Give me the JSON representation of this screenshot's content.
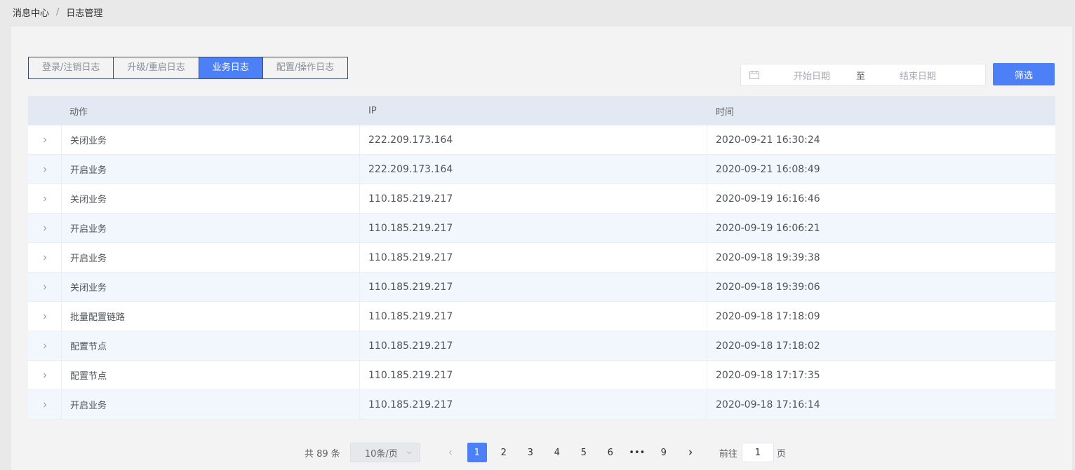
{
  "breadcrumb": {
    "parent": "消息中心",
    "separator": "/",
    "current": "日志管理"
  },
  "tabs": [
    {
      "label": "登录/注销日志",
      "active": false
    },
    {
      "label": "升级/重启日志",
      "active": false
    },
    {
      "label": "业务日志",
      "active": true
    },
    {
      "label": "配置/操作日志",
      "active": false
    }
  ],
  "date_range": {
    "start_placeholder": "开始日期",
    "separator": "至",
    "end_placeholder": "结束日期"
  },
  "filter_button": "筛选",
  "table": {
    "headers": {
      "action": "动作",
      "ip": "IP",
      "time": "时间"
    },
    "rows": [
      {
        "action": "关闭业务",
        "ip": "222.209.173.164",
        "time": "2020-09-21 16:30:24"
      },
      {
        "action": "开启业务",
        "ip": "222.209.173.164",
        "time": "2020-09-21 16:08:49"
      },
      {
        "action": "关闭业务",
        "ip": "110.185.219.217",
        "time": "2020-09-19 16:16:46"
      },
      {
        "action": "开启业务",
        "ip": "110.185.219.217",
        "time": "2020-09-19 16:06:21"
      },
      {
        "action": "开启业务",
        "ip": "110.185.219.217",
        "time": "2020-09-18 19:39:38"
      },
      {
        "action": "关闭业务",
        "ip": "110.185.219.217",
        "time": "2020-09-18 19:39:06"
      },
      {
        "action": "批量配置链路",
        "ip": "110.185.219.217",
        "time": "2020-09-18 17:18:09"
      },
      {
        "action": "配置节点",
        "ip": "110.185.219.217",
        "time": "2020-09-18 17:18:02"
      },
      {
        "action": "配置节点",
        "ip": "110.185.219.217",
        "time": "2020-09-18 17:17:35"
      },
      {
        "action": "开启业务",
        "ip": "110.185.219.217",
        "time": "2020-09-18 17:16:14"
      }
    ]
  },
  "pagination": {
    "total_text": "共 89 条",
    "page_size": "10条/页",
    "pages": [
      "1",
      "2",
      "3",
      "4",
      "5",
      "6",
      "•••",
      "9"
    ],
    "current_page": "1",
    "goto_prefix": "前往",
    "goto_value": "1",
    "goto_suffix": "页"
  },
  "colors": {
    "accent": "#4d80f6",
    "header_bg": "#e3e9f2",
    "stripe_bg": "#f2f6fd"
  }
}
